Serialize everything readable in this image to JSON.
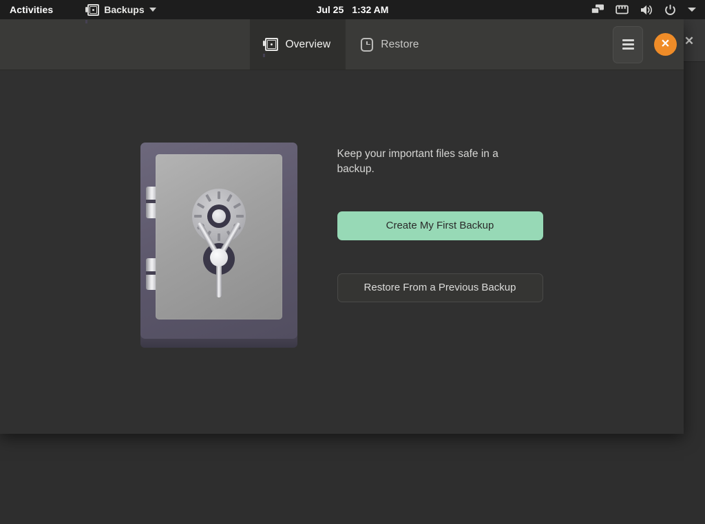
{
  "panel": {
    "activities": "Activities",
    "app_menu": {
      "label": "Backups",
      "icon": "safe-icon",
      "chevron": "chevron-down-icon"
    },
    "clock": {
      "date": "Jul 25",
      "time": "1:32 AM"
    },
    "tray": [
      {
        "name": "screen-share-icon"
      },
      {
        "name": "network-wired-icon"
      },
      {
        "name": "volume-icon"
      },
      {
        "name": "power-icon"
      },
      {
        "name": "chevron-down-icon"
      }
    ]
  },
  "window": {
    "title": "Backups",
    "view_switcher": [
      {
        "label": "Overview",
        "icon": "safe-icon",
        "active": true
      },
      {
        "label": "Restore",
        "icon": "clock-icon",
        "active": false
      }
    ],
    "menu_button": "main-menu",
    "close_button": "close"
  },
  "background_window": {
    "close_button": "✕"
  },
  "main": {
    "illustration": "safe-illustration",
    "description": "Keep your important files safe in a backup.",
    "primary_action": "Create My First Backup",
    "secondary_action": "Restore From a Previous Backup"
  },
  "colors": {
    "panel_bg": "#1d1d1d",
    "header_bg": "#3a3a38",
    "window_bg": "#303030",
    "accent_green": "#97d9b6",
    "close_orange": "#ef8c28",
    "text_primary": "#d6d6d4"
  }
}
